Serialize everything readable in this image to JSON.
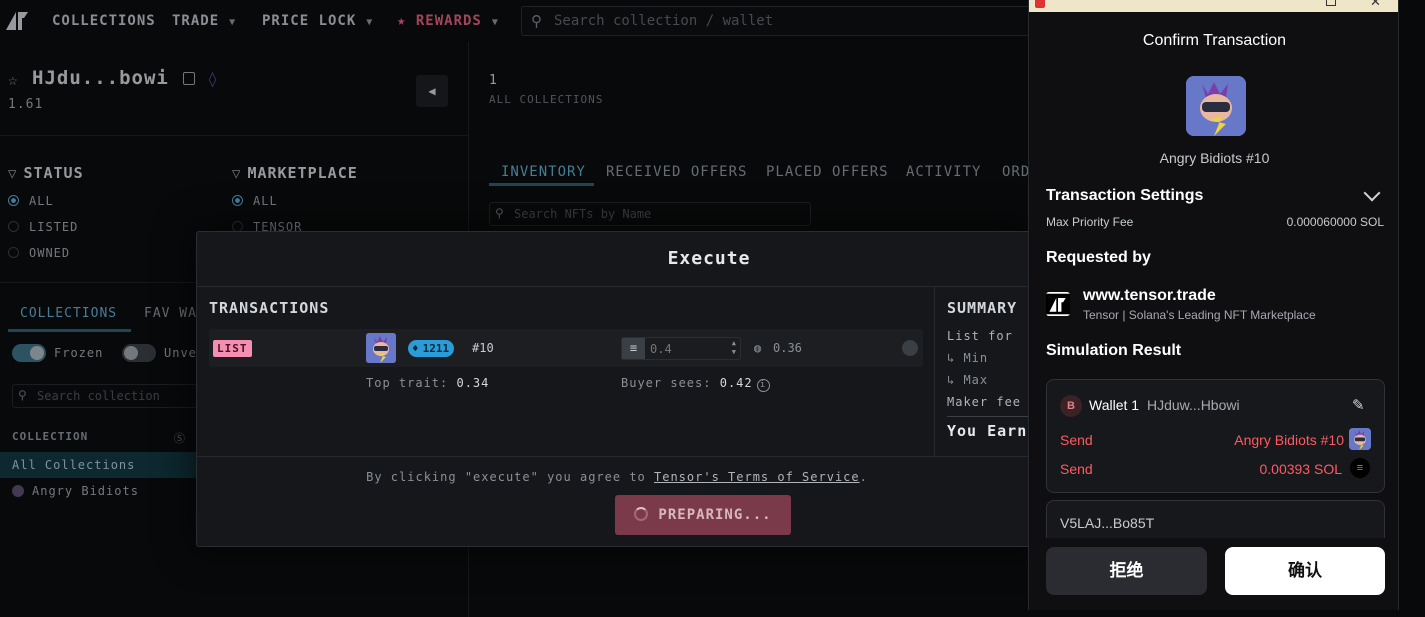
{
  "nav": {
    "items": [
      {
        "label": "COLLECTIONS"
      },
      {
        "label": "TRADE"
      },
      {
        "label": "PRICE LOCK"
      },
      {
        "label": "REWARDS"
      }
    ],
    "search_placeholder": "Search collection / wallet"
  },
  "profile": {
    "wallet_name": "HJdu...bowi",
    "balance": "1.61"
  },
  "stats": {
    "count": "1",
    "label": "ALL COLLECTIONS"
  },
  "filters": {
    "status": {
      "title": "STATUS",
      "options": [
        {
          "label": "ALL",
          "selected": true
        },
        {
          "label": "LISTED",
          "selected": false
        },
        {
          "label": "OWNED",
          "selected": false
        }
      ]
    },
    "marketplace": {
      "title": "MARKETPLACE",
      "options": [
        {
          "label": "ALL",
          "selected": true
        },
        {
          "label": "TENSOR",
          "selected": false
        }
      ]
    }
  },
  "collections_panel": {
    "tabs": [
      "COLLECTIONS",
      "FAV WA"
    ],
    "toggles": [
      {
        "label": "Frozen",
        "on": true
      },
      {
        "label": "Unve",
        "on": false
      }
    ],
    "search_placeholder": "Search collection",
    "column_header": "COLLECTION",
    "items": [
      "All Collections",
      "Angry Bidiots"
    ]
  },
  "main": {
    "tabs": [
      "INVENTORY",
      "RECEIVED OFFERS",
      "PLACED OFFERS",
      "ACTIVITY",
      "ORD"
    ],
    "search_placeholder": "Search NFTs by Name"
  },
  "execute_modal": {
    "title": "Execute",
    "transactions_header": "TRANSACTIONS",
    "row": {
      "action": "LIST",
      "rank": "1211",
      "nft_number": "#10",
      "price_placeholder": "0.4",
      "global_price": "0.36"
    },
    "top_trait_label": "Top trait:",
    "top_trait_value": "0.34",
    "buyer_sees_label": "Buyer sees:",
    "buyer_sees_value": "0.42",
    "summary": {
      "title": "SUMMARY",
      "list_for": "List for",
      "min": "↳ Min",
      "max": "↳ Max",
      "maker_fee": "Maker fee",
      "you_earn": "You Earn"
    },
    "agree_prefix": "By clicking \"execute\" you agree to ",
    "agree_link": "Tensor's Terms of Service",
    "agree_suffix": ".",
    "button_label": "PREPARING..."
  },
  "wallet_popup": {
    "title": "Confirm Transaction",
    "nft_name": "Angry Bidiots #10",
    "settings_title": "Transaction Settings",
    "fee_label": "Max Priority Fee",
    "fee_value": "0.000060000 SOL",
    "requested_by": "Requested by",
    "site_url": "www.tensor.trade",
    "site_desc": "Tensor | Solana's Leading NFT Marketplace",
    "simulation_title": "Simulation Result",
    "account_initial": "B",
    "account_name": "Wallet 1",
    "account_address": "HJduw...Hbowi",
    "sends": [
      {
        "label": "Send",
        "value": "Angry Bidiots #10"
      },
      {
        "label": "Send",
        "value": "0.00393 SOL"
      }
    ],
    "second_account": "V5LAJ...Bo85T",
    "reject_label": "拒绝",
    "approve_label": "确认"
  },
  "colors": {
    "accent": "#5fa6c8",
    "rewards": "#d85c7a",
    "send_red": "#ff5a63",
    "list_badge": "#f48fb1"
  }
}
